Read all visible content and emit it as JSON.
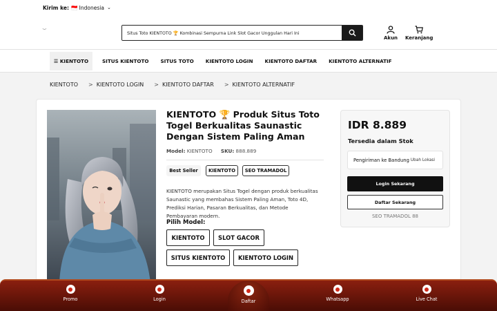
{
  "topbar": {
    "label": "Kirim ke:",
    "location": "🇮🇩 Indonesia"
  },
  "header": {
    "logo_text": "‿",
    "search_value": "Situs Toto KIENTOTO 🏆 Kombinasi Sempurna Link Slot Gacor Unggulan Hari Ini",
    "account_label": "Akun",
    "cart_label": "Keranjang"
  },
  "nav": {
    "brand": "☰ KIENTOTO",
    "items": [
      "SITUS KIENTOTO",
      "SITUS TOTO",
      "KIENTOTO LOGIN",
      "KIENTOTO DAFTAR",
      "KIENTOTO ALTERNATIF"
    ]
  },
  "breadcrumb": {
    "items": [
      "KIENTOTO",
      "KIENTOTO LOGIN",
      "KIENTOTO DAFTAR",
      "KIENTOTO ALTERNATIF"
    ],
    "separator": ">"
  },
  "product": {
    "title": "KIENTOTO 🏆 Produk Situs Toto Togel Berkualitas Saunastic Dengan Sistem Paling Aman",
    "model_label": "Model:",
    "model_value": "KIENTOTO",
    "sku_label": "SKU:",
    "sku_value": "888.889",
    "tags": [
      "Best Seller",
      "KIENTOTO",
      "SEO TRAMADOL"
    ],
    "description": "KIENTOTO merupakan Situs Togel dengan produk berkualitas Saunastic yang membahas Sistem Paling Aman, Toto 4D, Prediksi Harian, Pasaran Berkualitas, dan Metode Pembayaran modern.",
    "choose_model_label": "Pilih Model:",
    "model_options": [
      "KIENTOTO",
      "SLOT GACOR",
      "SITUS KIENTOTO",
      "KIENTOTO LOGIN"
    ]
  },
  "purchase": {
    "price": "IDR 8.889",
    "stock": "Tersedia dalam Stok",
    "shipping": "Pengiriman ke Bandung",
    "change_location": "Ubah Lokasi",
    "login_button": "Login Sekarang",
    "register_button": "Daftar Sekarang",
    "note": "SEO TRAMADOL 88"
  },
  "footer": {
    "items": [
      "Promo",
      "Login",
      "Daftar",
      "Whatsapp",
      "Live Chat"
    ]
  },
  "colors": {
    "footer_gradient_top": "#8a1f0f",
    "footer_gradient_bottom": "#4a0d05",
    "primary_button": "#111111",
    "icon_accent": "#d12a1a"
  },
  "icons": {
    "search": "search-icon",
    "account": "user-icon",
    "cart": "cart-icon",
    "footer": "chip-icon"
  }
}
